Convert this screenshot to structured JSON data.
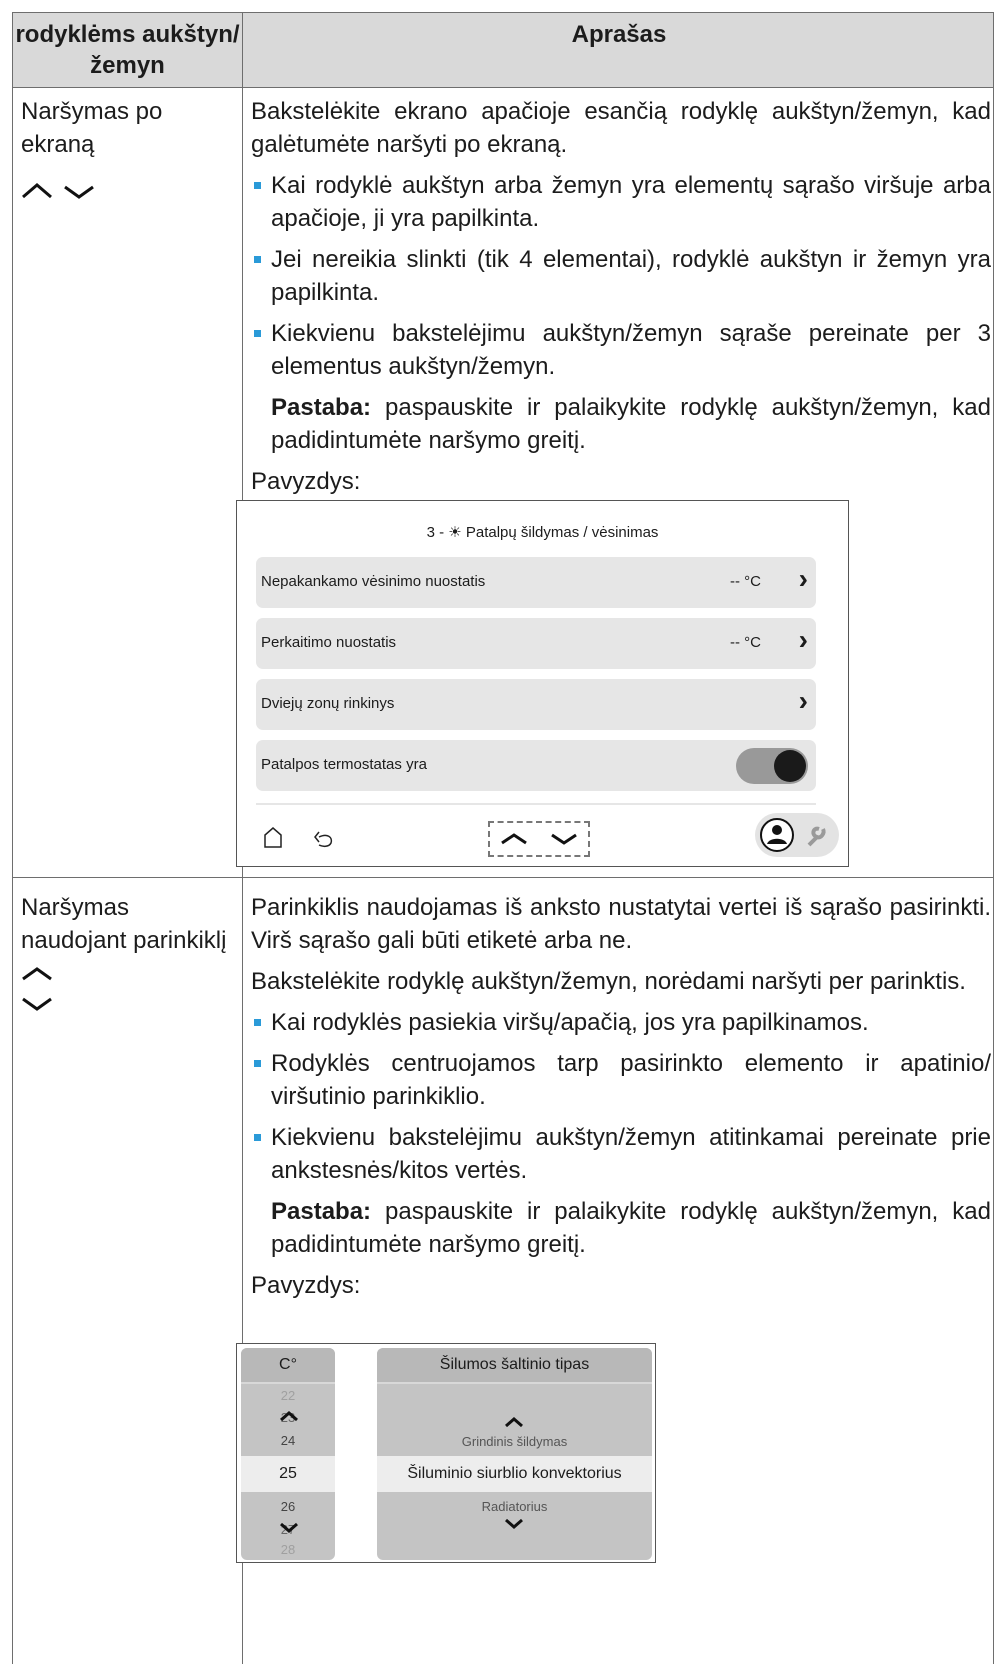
{
  "header": {
    "col1": "rodyklėms aukštyn/žemyn",
    "col2": "Aprašas"
  },
  "row1": {
    "left_title": "Naršymas po ekraną",
    "intro": "Bakstelėkite ekrano apačioje esančią rodyklę aukštyn/žemyn, kad galėtumėte naršyti po ekraną.",
    "bullets": [
      "Kai rodyklė aukštyn arba žemyn yra elementų sąrašo viršuje arba apačioje, ji yra papilkinta.",
      "Jei nereikia slinkti (tik 4 elementai), rodyklė aukštyn ir žemyn yra papilkinta.",
      "Kiekvienu bakstelėjimu aukštyn/žemyn sąraše pereinate per 3 elementus aukštyn/žemyn."
    ],
    "note_label": "Pastaba:",
    "note_text": " paspauskite ir palaikykite rodyklę aukštyn/žemyn, kad padidintumėte naršymo greitį.",
    "example_label": "Pavyzdys:",
    "screen": {
      "title": "3 - ☀ Patalpų šildymas / vėsinimas",
      "rows": [
        {
          "label": "Nepakankamo vėsinimo nuostatis",
          "value": "-- °C"
        },
        {
          "label": "Perkaitimo nuostatis",
          "value": "-- °C"
        },
        {
          "label": "Dviejų zonų rinkinys",
          "value": ""
        },
        {
          "label": "Patalpos termostatas yra",
          "value": ""
        }
      ]
    }
  },
  "row2": {
    "left_title": "Naršymas naudojant parinkiklį",
    "p1": "Parinkiklis naudojamas iš anksto nustatytai vertei iš sąrašo pasirinkti. Virš sąrašo gali būti etiketė arba ne.",
    "p2": "Bakstelėkite rodyklę aukštyn/žemyn, norėdami naršyti per parinktis.",
    "bullets": [
      "Kai rodyklės pasiekia viršų/apačią, jos yra papilkinamos.",
      "Rodyklės centruojamos tarp pasirinkto elemento ir apatinio/ viršutinio parinkiklio.",
      "Kiekvienu bakstelėjimu aukštyn/žemyn atitinkamai pereinate prie ankstesnės/kitos vertės."
    ],
    "note_label": "Pastaba:",
    "note_text": " paspauskite ir palaikykite rodyklę aukštyn/žemyn, kad padidintumėte naršymo greitį.",
    "example_label": "Pavyzdys:",
    "picker": {
      "unit": "C°",
      "numbers": [
        "22",
        "23",
        "24",
        "25",
        "26",
        "27",
        "28"
      ],
      "title": "Šilumos šaltinio tipas",
      "options": [
        "Grindinis šildymas",
        "Šiluminio siurblio konvektorius",
        "Radiatorius"
      ]
    }
  }
}
